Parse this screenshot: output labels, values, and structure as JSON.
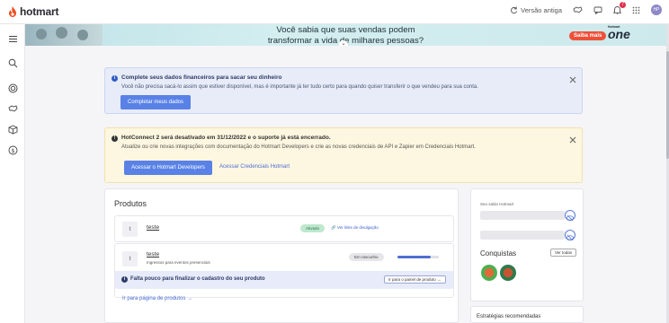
{
  "topbar": {
    "brand": "hotmart",
    "old_version_label": "Versão antiga",
    "notification_count": "7",
    "avatar_initials": "HP",
    "icons": [
      "refresh-icon",
      "handshake-icon",
      "chat-icon",
      "bell-icon",
      "grid-icon"
    ]
  },
  "sidebar": {
    "items": [
      "menu-icon",
      "search-icon",
      "target-icon",
      "handshake-icon",
      "box-icon",
      "dollar-icon"
    ]
  },
  "banner": {
    "line1": "Você sabia que suas vendas podem",
    "line2": "transformar a vida de milhares pessoas?",
    "cta": "Saiba mais",
    "event_small": "Hotmart",
    "event_name": "one"
  },
  "alerts": {
    "financial": {
      "title": "Complete seus dados financeiros para sacar seu dinheiro",
      "description": "Você não precisa sacá-lo assim que estiver disponível, mas é importante já ter tudo certo para quando quiser transferir o que vendeu para sua conta.",
      "button": "Completar meus dados"
    },
    "hotconnect": {
      "title": "HotConnect 2 será desativado em 31/12/2022 e o suporte já está encerrado.",
      "description": "Atualize ou crie novas integrações com documentação do Hotmart Developers e crie as novas credenciais de API e Zapier em Credenciais Hotmart.",
      "button": "Acessar o Hotmart Developers",
      "link": "Acessar Credenciais Hotmart"
    }
  },
  "products": {
    "title": "Produtos",
    "items": [
      {
        "initial": "t",
        "name": "teste",
        "status": "Ativado",
        "link": "Ver links de divulgação"
      },
      {
        "initial": "t",
        "name": "teste",
        "subtitle": "Ingressos para eventos presenciais",
        "status": "Em rascunho",
        "progress": 0.8,
        "warning": "Falta pouco para finalizar o cadastro do seu produto",
        "warning_button": "Ir para o painel de produto →"
      }
    ],
    "footer_link": "Ir para página de produtos →"
  },
  "side": {
    "balance_label": "Seu saldo Hotmart",
    "achievements_title": "Conquistas",
    "see_all": "Ver todas"
  },
  "strategies": {
    "title": "Estratégias recomendadas"
  },
  "colors": {
    "brand": "#f04e23",
    "primary": "#5981e6",
    "info_bg": "#e7ecf8",
    "warn_bg": "#fdf6e0",
    "success": "#bfe8cf"
  }
}
